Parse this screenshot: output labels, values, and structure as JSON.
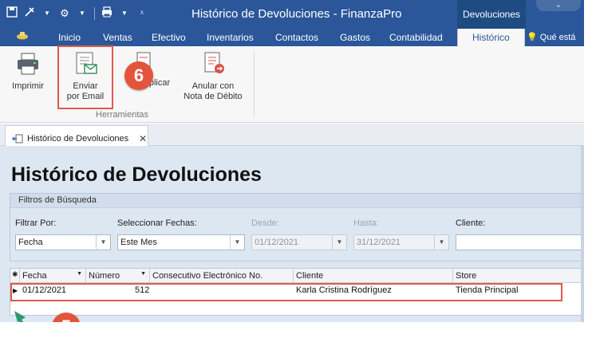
{
  "window": {
    "title": "Histórico de Devoluciones - FinanzaPro",
    "context_tab": "Devoluciones",
    "tell_me": "Qué está"
  },
  "ribbon_tabs": [
    "Inicio",
    "Ventas",
    "Efectivo",
    "Inventarios",
    "Contactos",
    "Gastos",
    "Contabilidad",
    "Histórico"
  ],
  "ribbon": {
    "print_label": "Imprimir",
    "email_label_1": "Enviar",
    "email_label_2": "por Email",
    "duplicate_label": "Duplicar",
    "annul_label_1": "Anular con",
    "annul_label_2": "Nota de Débito",
    "group_label": "Herramientas"
  },
  "doc_tab": {
    "label": "Histórico de Devoluciones"
  },
  "page_title": "Histórico de Devoluciones",
  "filters": {
    "title": "Filtros de Búsqueda",
    "filter_by_label": "Filtrar Por:",
    "filter_by_value": "Fecha",
    "select_dates_label": "Seleccionar Fechas:",
    "select_dates_value": "Este Mes",
    "from_label": "Desde:",
    "from_value": "01/12/2021",
    "to_label": "Hasta:",
    "to_value": "31/12/2021",
    "client_label": "Cliente:",
    "client_value": ""
  },
  "grid": {
    "columns": [
      "Fecha",
      "Número",
      "Consecutivo Electrónico No.",
      "Cliente",
      "Store"
    ],
    "rows": [
      {
        "fecha": "01/12/2021",
        "numero": "512",
        "consecutivo": "",
        "cliente": "Karla Cristina Rodríguez",
        "store": "Tienda Principal"
      }
    ]
  },
  "callouts": {
    "email_step": "6",
    "row_step": "5"
  },
  "colors": {
    "ribbon_blue": "#2b579a",
    "callout_red": "#e4543d",
    "arrow_green": "#2a9a73"
  }
}
